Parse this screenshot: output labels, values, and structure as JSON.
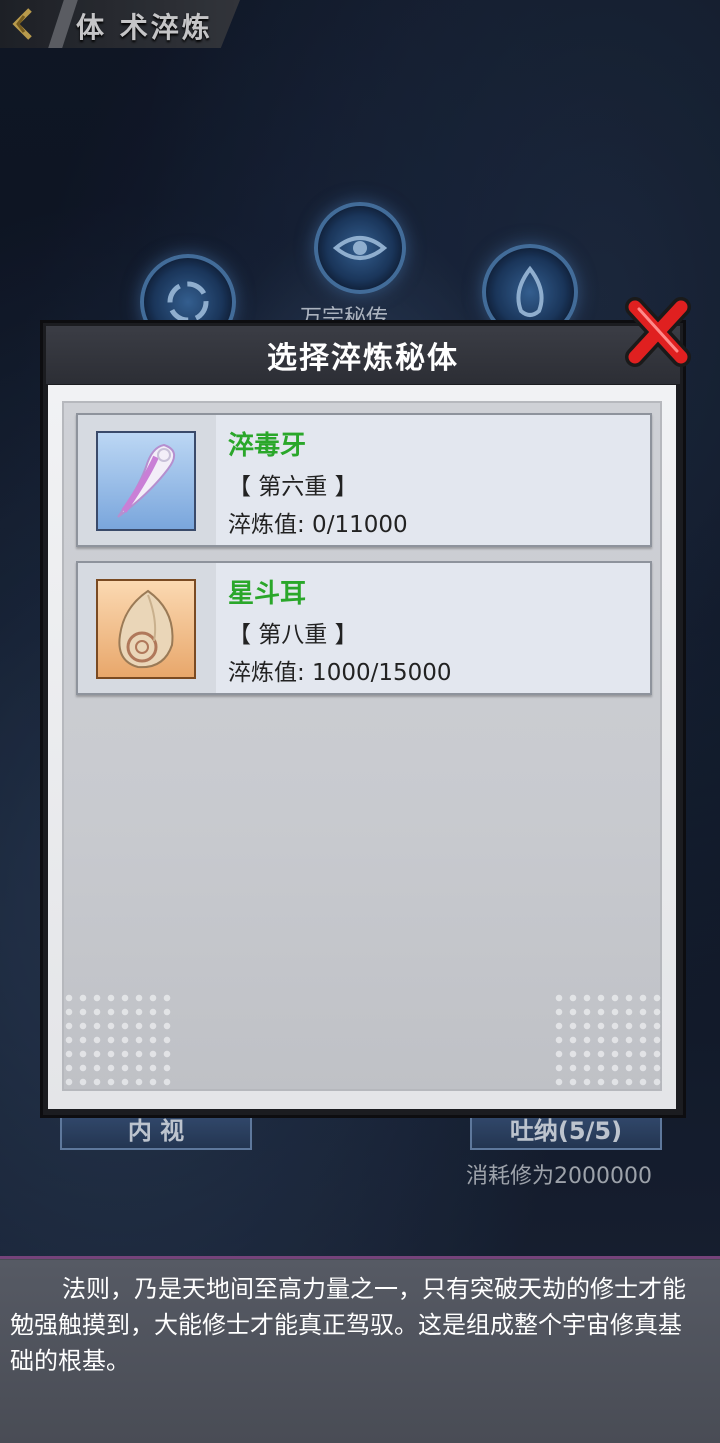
{
  "header": {
    "title": "体 术淬炼",
    "back_icon": "back-arrow-icon"
  },
  "background": {
    "medallion_label": "万宗秘传",
    "left_button_label": "内 视",
    "right_button_label": "吐纳(5/5)",
    "cost_text": "消耗修为2000000"
  },
  "dialog": {
    "title": "选择淬炼秘体",
    "close_icon": "close-x-icon",
    "items": [
      {
        "name": "淬毒牙",
        "tier": "【 第六重 】",
        "value": "淬炼值: 0/11000",
        "icon": "fang-icon"
      },
      {
        "name": "星斗耳",
        "tier": "【 第八重 】",
        "value": "淬炼值: 1000/15000",
        "icon": "shell-ear-icon"
      }
    ]
  },
  "description": {
    "text": "法则，乃是天地间至高力量之一，只有突破天劫的修士才能勉强触摸到，大能修士才能真正驾驭。这是组成整个宇宙修真基础的根基。"
  },
  "colors": {
    "item_name": "#2aa72a",
    "close_red": "#e02020",
    "accent_gold": "#d9b55a"
  }
}
